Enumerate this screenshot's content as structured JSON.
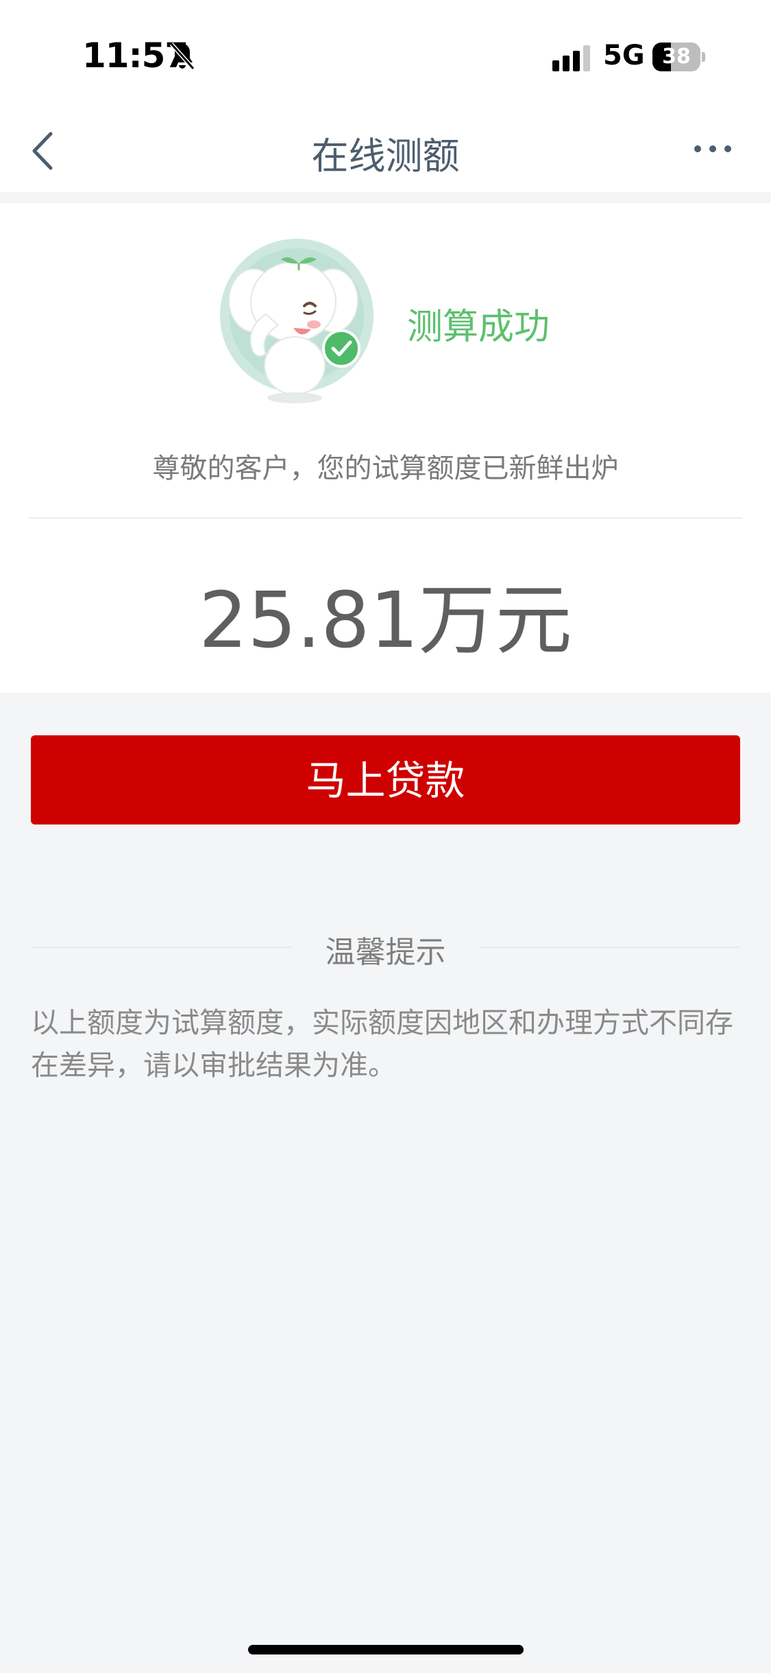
{
  "status_bar": {
    "time": "11:57",
    "network": "5G",
    "battery_level": "38",
    "battery_fraction": 0.38
  },
  "nav": {
    "title": "在线测额",
    "back_icon": "chevron-left-icon",
    "more_icon": "more-horizontal-icon"
  },
  "result": {
    "mascot_icon": "elephant-mascot-check-icon",
    "status_text": "测算成功",
    "subtitle": "尊敬的客户，您的试算额度已新鲜出炉",
    "amount": "25.81万元"
  },
  "action": {
    "loan_button_label": "马上贷款"
  },
  "tips": {
    "title": "温馨提示",
    "body": "以上额度为试算额度，实际额度因地区和办理方式不同存在差异，请以审批结果为准。"
  },
  "colors": {
    "accent_red": "#cf0000",
    "success_green": "#5cc06d",
    "title_color": "#4d5d6e",
    "page_background": "#f4f5f7"
  }
}
